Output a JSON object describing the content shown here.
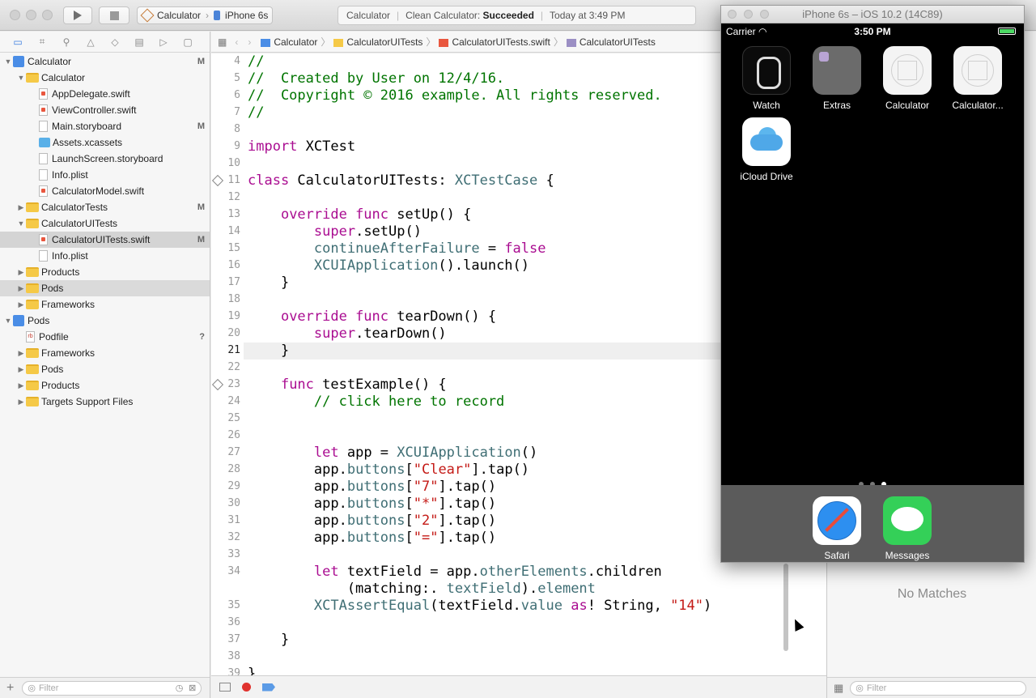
{
  "toolbar": {
    "scheme_target": "Calculator",
    "scheme_device": "iPhone 6s",
    "activity_project": "Calculator",
    "activity_status_prefix": "Clean Calculator:",
    "activity_status": "Succeeded",
    "activity_time": "Today at 3:49 PM"
  },
  "navigator": {
    "filter_placeholder": "Filter",
    "tree": [
      {
        "label": "Calculator",
        "kind": "project",
        "depth": 0,
        "open": true,
        "badge": "M"
      },
      {
        "label": "Calculator",
        "kind": "folder",
        "depth": 1,
        "open": true,
        "badge": ""
      },
      {
        "label": "AppDelegate.swift",
        "kind": "swift",
        "depth": 2,
        "badge": ""
      },
      {
        "label": "ViewController.swift",
        "kind": "swift",
        "depth": 2,
        "badge": ""
      },
      {
        "label": "Main.storyboard",
        "kind": "plain",
        "depth": 2,
        "badge": "M"
      },
      {
        "label": "Assets.xcassets",
        "kind": "asset",
        "depth": 2,
        "badge": ""
      },
      {
        "label": "LaunchScreen.storyboard",
        "kind": "plain",
        "depth": 2,
        "badge": ""
      },
      {
        "label": "Info.plist",
        "kind": "plain",
        "depth": 2,
        "badge": ""
      },
      {
        "label": "CalculatorModel.swift",
        "kind": "swift",
        "depth": 2,
        "badge": ""
      },
      {
        "label": "CalculatorTests",
        "kind": "folder",
        "depth": 1,
        "open": false,
        "badge": "M"
      },
      {
        "label": "CalculatorUITests",
        "kind": "folder",
        "depth": 1,
        "open": true,
        "badge": ""
      },
      {
        "label": "CalculatorUITests.swift",
        "kind": "swift",
        "depth": 2,
        "badge": "M",
        "selected": true
      },
      {
        "label": "Info.plist",
        "kind": "plain",
        "depth": 2,
        "badge": ""
      },
      {
        "label": "Products",
        "kind": "folder",
        "depth": 1,
        "open": false,
        "badge": ""
      },
      {
        "label": "Pods",
        "kind": "folder",
        "depth": 1,
        "open": false,
        "badge": "",
        "highlight": true
      },
      {
        "label": "Frameworks",
        "kind": "folder",
        "depth": 1,
        "open": false,
        "badge": ""
      },
      {
        "label": "Pods",
        "kind": "project",
        "depth": 0,
        "open": true,
        "badge": ""
      },
      {
        "label": "Podfile",
        "kind": "rb",
        "depth": 1,
        "badge": "?"
      },
      {
        "label": "Frameworks",
        "kind": "folder",
        "depth": 1,
        "open": false,
        "badge": ""
      },
      {
        "label": "Pods",
        "kind": "folder",
        "depth": 1,
        "open": false,
        "badge": ""
      },
      {
        "label": "Products",
        "kind": "folder",
        "depth": 1,
        "open": false,
        "badge": ""
      },
      {
        "label": "Targets Support Files",
        "kind": "folder",
        "depth": 1,
        "open": false,
        "badge": ""
      }
    ]
  },
  "jumpbar": {
    "crumbs": [
      "Calculator",
      "CalculatorUITests",
      "CalculatorUITests.swift",
      "CalculatorUITests"
    ]
  },
  "editor": {
    "current_line": "21",
    "lines": [
      {
        "n": "4",
        "tokens": [
          {
            "c": "cm",
            "t": "//"
          }
        ]
      },
      {
        "n": "5",
        "tokens": [
          {
            "c": "cm",
            "t": "//  Created by User on 12/4/16."
          }
        ]
      },
      {
        "n": "6",
        "tokens": [
          {
            "c": "cm",
            "t": "//  Copyright © 2016 example. All rights reserved."
          }
        ]
      },
      {
        "n": "7",
        "tokens": [
          {
            "c": "cm",
            "t": "//"
          }
        ]
      },
      {
        "n": "8",
        "tokens": []
      },
      {
        "n": "9",
        "tokens": [
          {
            "c": "kw",
            "t": "import"
          },
          {
            "c": "pl",
            "t": " XCTest"
          }
        ]
      },
      {
        "n": "10",
        "tokens": []
      },
      {
        "n": "11",
        "bp": true,
        "tokens": [
          {
            "c": "kw",
            "t": "class"
          },
          {
            "c": "pl",
            "t": " CalculatorUITests: "
          },
          {
            "c": "ty",
            "t": "XCTestCase"
          },
          {
            "c": "pl",
            "t": " {"
          }
        ]
      },
      {
        "n": "12",
        "tokens": []
      },
      {
        "n": "13",
        "tokens": [
          {
            "c": "pl",
            "t": "    "
          },
          {
            "c": "kw",
            "t": "override func"
          },
          {
            "c": "pl",
            "t": " setUp() {"
          }
        ]
      },
      {
        "n": "14",
        "tokens": [
          {
            "c": "pl",
            "t": "        "
          },
          {
            "c": "kw",
            "t": "super"
          },
          {
            "c": "pl",
            "t": ".setUp()"
          }
        ]
      },
      {
        "n": "15",
        "tokens": [
          {
            "c": "pl",
            "t": "        "
          },
          {
            "c": "ty",
            "t": "continueAfterFailure"
          },
          {
            "c": "pl",
            "t": " = "
          },
          {
            "c": "kw",
            "t": "false"
          }
        ]
      },
      {
        "n": "16",
        "tokens": [
          {
            "c": "pl",
            "t": "        "
          },
          {
            "c": "ty",
            "t": "XCUIApplication"
          },
          {
            "c": "pl",
            "t": "().launch()"
          }
        ]
      },
      {
        "n": "17",
        "tokens": [
          {
            "c": "pl",
            "t": "    }"
          }
        ]
      },
      {
        "n": "18",
        "tokens": []
      },
      {
        "n": "19",
        "tokens": [
          {
            "c": "pl",
            "t": "    "
          },
          {
            "c": "kw",
            "t": "override func"
          },
          {
            "c": "pl",
            "t": " tearDown() {"
          }
        ]
      },
      {
        "n": "20",
        "tokens": [
          {
            "c": "pl",
            "t": "        "
          },
          {
            "c": "kw",
            "t": "super"
          },
          {
            "c": "pl",
            "t": ".tearDown()"
          }
        ]
      },
      {
        "n": "21",
        "tokens": [
          {
            "c": "pl",
            "t": "    }"
          }
        ]
      },
      {
        "n": "22",
        "tokens": []
      },
      {
        "n": "23",
        "bp": true,
        "tokens": [
          {
            "c": "pl",
            "t": "    "
          },
          {
            "c": "kw",
            "t": "func"
          },
          {
            "c": "pl",
            "t": " testExample() {"
          }
        ]
      },
      {
        "n": "24",
        "tokens": [
          {
            "c": "pl",
            "t": "        "
          },
          {
            "c": "cm",
            "t": "// click here to record"
          }
        ]
      },
      {
        "n": "25",
        "tokens": []
      },
      {
        "n": "26",
        "tokens": []
      },
      {
        "n": "27",
        "tokens": [
          {
            "c": "pl",
            "t": "        "
          },
          {
            "c": "kw",
            "t": "let"
          },
          {
            "c": "pl",
            "t": " app = "
          },
          {
            "c": "ty",
            "t": "XCUIApplication"
          },
          {
            "c": "pl",
            "t": "()"
          }
        ]
      },
      {
        "n": "28",
        "tokens": [
          {
            "c": "pl",
            "t": "        app."
          },
          {
            "c": "ty",
            "t": "buttons"
          },
          {
            "c": "pl",
            "t": "["
          },
          {
            "c": "st",
            "t": "\"Clear\""
          },
          {
            "c": "pl",
            "t": "].tap()"
          }
        ]
      },
      {
        "n": "29",
        "tokens": [
          {
            "c": "pl",
            "t": "        app."
          },
          {
            "c": "ty",
            "t": "buttons"
          },
          {
            "c": "pl",
            "t": "["
          },
          {
            "c": "st",
            "t": "\"7\""
          },
          {
            "c": "pl",
            "t": "].tap()"
          }
        ]
      },
      {
        "n": "30",
        "tokens": [
          {
            "c": "pl",
            "t": "        app."
          },
          {
            "c": "ty",
            "t": "buttons"
          },
          {
            "c": "pl",
            "t": "["
          },
          {
            "c": "st",
            "t": "\"*\""
          },
          {
            "c": "pl",
            "t": "].tap()"
          }
        ]
      },
      {
        "n": "31",
        "tokens": [
          {
            "c": "pl",
            "t": "        app."
          },
          {
            "c": "ty",
            "t": "buttons"
          },
          {
            "c": "pl",
            "t": "["
          },
          {
            "c": "st",
            "t": "\"2\""
          },
          {
            "c": "pl",
            "t": "].tap()"
          }
        ]
      },
      {
        "n": "32",
        "tokens": [
          {
            "c": "pl",
            "t": "        app."
          },
          {
            "c": "ty",
            "t": "buttons"
          },
          {
            "c": "pl",
            "t": "["
          },
          {
            "c": "st",
            "t": "\"=\""
          },
          {
            "c": "pl",
            "t": "].tap()"
          }
        ]
      },
      {
        "n": "33",
        "tokens": []
      },
      {
        "n": "34",
        "tokens": [
          {
            "c": "pl",
            "t": "        "
          },
          {
            "c": "kw",
            "t": "let"
          },
          {
            "c": "pl",
            "t": " textField = app."
          },
          {
            "c": "ty",
            "t": "otherElements"
          },
          {
            "c": "pl",
            "t": ".children"
          }
        ]
      },
      {
        "n": "",
        "tokens": [
          {
            "c": "pl",
            "t": "            (matching:. "
          },
          {
            "c": "ty",
            "t": "textField"
          },
          {
            "c": "pl",
            "t": ")."
          },
          {
            "c": "ty",
            "t": "element"
          }
        ]
      },
      {
        "n": "35",
        "tokens": [
          {
            "c": "pl",
            "t": "        "
          },
          {
            "c": "ty",
            "t": "XCTAssertEqual"
          },
          {
            "c": "pl",
            "t": "(textField."
          },
          {
            "c": "ty",
            "t": "value"
          },
          {
            "c": "pl",
            "t": " "
          },
          {
            "c": "kw",
            "t": "as"
          },
          {
            "c": "pl",
            "t": "! String, "
          },
          {
            "c": "st",
            "t": "\"14\""
          },
          {
            "c": "pl",
            "t": ")"
          }
        ]
      },
      {
        "n": "36",
        "tokens": []
      },
      {
        "n": "37",
        "tokens": [
          {
            "c": "pl",
            "t": "    }"
          }
        ]
      },
      {
        "n": "38",
        "tokens": []
      },
      {
        "n": "39",
        "tokens": [
          {
            "c": "pl",
            "t": "}"
          }
        ]
      }
    ]
  },
  "utility": {
    "no_matches": "No Matches",
    "filter_placeholder": "Filter"
  },
  "simulator": {
    "title": "iPhone 6s – iOS 10.2 (14C89)",
    "carrier": "Carrier",
    "time": "3:50 PM",
    "apps": [
      {
        "label": "Watch",
        "icon": "watch-icon"
      },
      {
        "label": "Extras",
        "icon": "extras-folder-icon"
      },
      {
        "label": "Calculator",
        "icon": "calculator-app-icon"
      },
      {
        "label": "Calculator...",
        "icon": "calculator-ui-tests-app-icon"
      },
      {
        "label": "iCloud Drive",
        "icon": "icloud-drive-icon"
      }
    ],
    "dock": [
      {
        "label": "Safari",
        "icon": "safari-icon"
      },
      {
        "label": "Messages",
        "icon": "messages-icon"
      }
    ],
    "pages": 3,
    "active_page": 3
  }
}
